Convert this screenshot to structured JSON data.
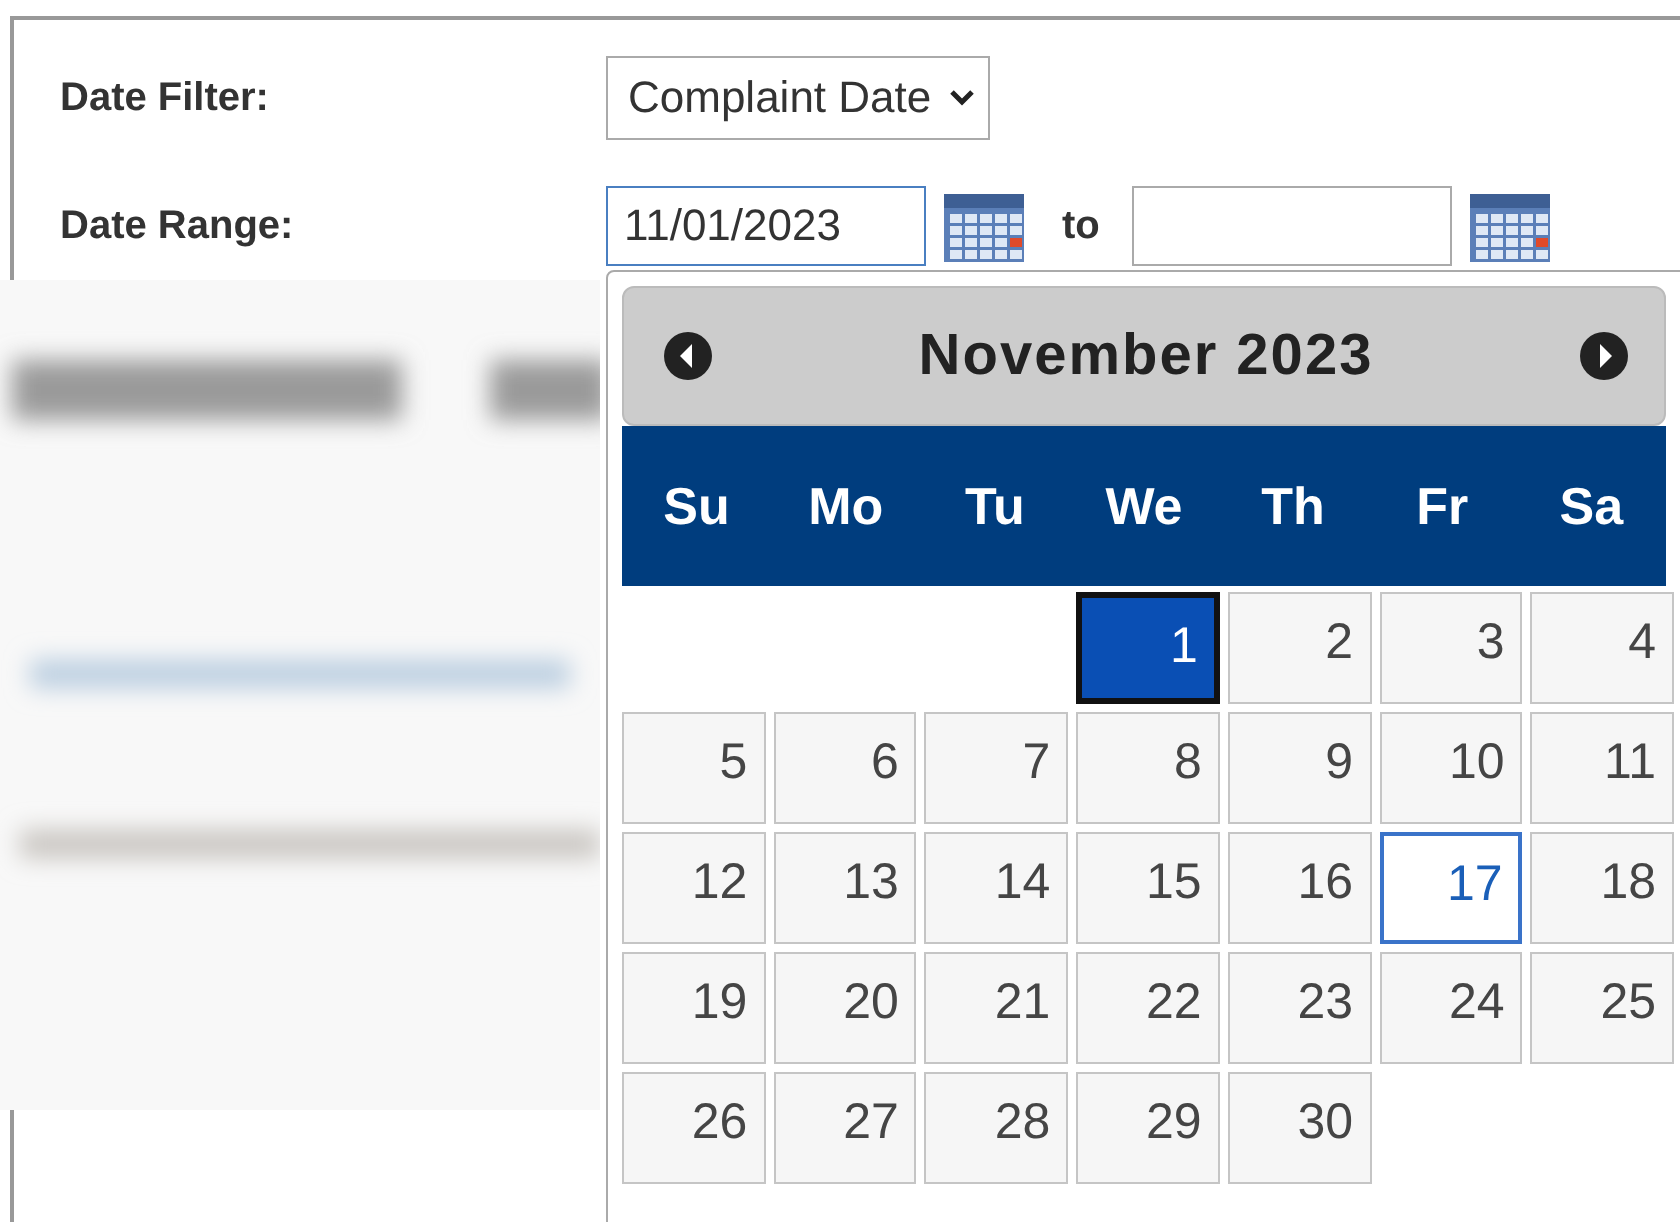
{
  "filters": [
    {
      "label": "Date Filter:",
      "kind": "select",
      "value": "Complaint Date"
    },
    {
      "label": "Date Range:",
      "kind": "range",
      "from": "11/01/2023",
      "joiner": "to"
    }
  ],
  "datepicker": {
    "month_title": "November 2023",
    "weekdays": [
      "Su",
      "Mo",
      "Tu",
      "We",
      "Th",
      "Fr",
      "Sa"
    ],
    "weeks": [
      [
        {
          "kind": "blank"
        },
        {
          "kind": "blank"
        },
        {
          "kind": "blank"
        },
        {
          "kind": "day",
          "label": "1",
          "selected": true,
          "today": false
        },
        {
          "kind": "day",
          "label": "2",
          "selected": false,
          "today": false
        },
        {
          "kind": "day",
          "label": "3",
          "selected": false,
          "today": false
        },
        {
          "kind": "day",
          "label": "4",
          "selected": false,
          "today": false
        }
      ],
      [
        {
          "kind": "day",
          "label": "5",
          "selected": false,
          "today": false
        },
        {
          "kind": "day",
          "label": "6",
          "selected": false,
          "today": false
        },
        {
          "kind": "day",
          "label": "7",
          "selected": false,
          "today": false
        },
        {
          "kind": "day",
          "label": "8",
          "selected": false,
          "today": false
        },
        {
          "kind": "day",
          "label": "9",
          "selected": false,
          "today": false
        },
        {
          "kind": "day",
          "label": "10",
          "selected": false,
          "today": false
        },
        {
          "kind": "day",
          "label": "11",
          "selected": false,
          "today": false
        }
      ],
      [
        {
          "kind": "day",
          "label": "12",
          "selected": false,
          "today": false
        },
        {
          "kind": "day",
          "label": "13",
          "selected": false,
          "today": false
        },
        {
          "kind": "day",
          "label": "14",
          "selected": false,
          "today": false
        },
        {
          "kind": "day",
          "label": "15",
          "selected": false,
          "today": false
        },
        {
          "kind": "day",
          "label": "16",
          "selected": false,
          "today": false
        },
        {
          "kind": "day",
          "label": "17",
          "selected": false,
          "today": true
        },
        {
          "kind": "day",
          "label": "18",
          "selected": false,
          "today": false
        }
      ],
      [
        {
          "kind": "day",
          "label": "19",
          "selected": false,
          "today": false
        },
        {
          "kind": "day",
          "label": "20",
          "selected": false,
          "today": false
        },
        {
          "kind": "day",
          "label": "21",
          "selected": false,
          "today": false
        },
        {
          "kind": "day",
          "label": "22",
          "selected": false,
          "today": false
        },
        {
          "kind": "day",
          "label": "23",
          "selected": false,
          "today": false
        },
        {
          "kind": "day",
          "label": "24",
          "selected": false,
          "today": false
        },
        {
          "kind": "day",
          "label": "25",
          "selected": false,
          "today": false
        }
      ],
      [
        {
          "kind": "day",
          "label": "26",
          "selected": false,
          "today": false
        },
        {
          "kind": "day",
          "label": "27",
          "selected": false,
          "today": false
        },
        {
          "kind": "day",
          "label": "28",
          "selected": false,
          "today": false
        },
        {
          "kind": "day",
          "label": "29",
          "selected": false,
          "today": false
        },
        {
          "kind": "day",
          "label": "30",
          "selected": false,
          "today": false
        },
        {
          "kind": "blank"
        },
        {
          "kind": "blank"
        }
      ]
    ]
  }
}
